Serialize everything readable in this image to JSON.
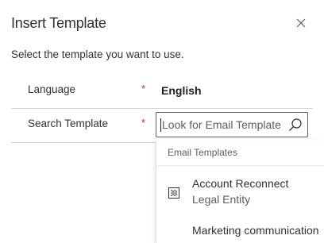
{
  "dialog": {
    "title": "Insert Template",
    "instruction": "Select the template you want to use."
  },
  "fields": {
    "language": {
      "label": "Language",
      "required_marker": "*",
      "value": "English"
    },
    "search": {
      "label": "Search Template",
      "required_marker": "*",
      "placeholder": "Look for Email Template"
    }
  },
  "dropdown": {
    "header": "Email Templates",
    "items": [
      {
        "title": "Account Reconnect",
        "subtitle": "Legal Entity",
        "icon": "template-icon"
      },
      {
        "title": "Marketing communication",
        "subtitle": "",
        "icon": ""
      }
    ]
  },
  "icons": {
    "close": "close-icon",
    "search": "search-icon"
  },
  "colors": {
    "required": "#c4314b",
    "text": "#323130",
    "muted": "#605e5c",
    "border": "#605e5c"
  }
}
